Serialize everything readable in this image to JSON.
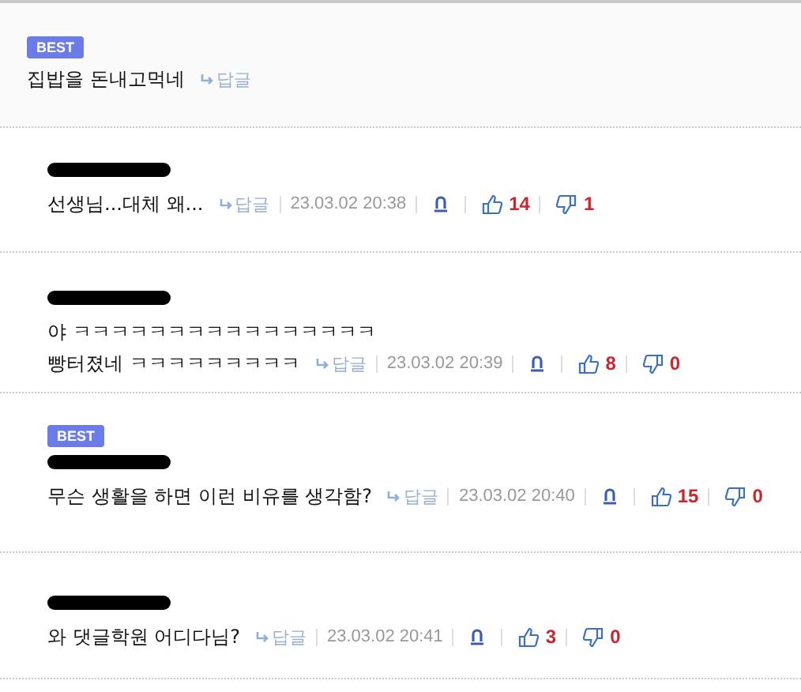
{
  "comments": [
    {
      "kind": "parent",
      "badge": "BEST",
      "lines": [
        "집밥을 돈내고먹네"
      ],
      "reply_label": "답글"
    },
    {
      "kind": "reply",
      "lines": [
        "선생님...대체 왜..."
      ],
      "reply_label": "답글",
      "date": "23.03.02 20:38",
      "likes": "14",
      "dislikes": "1"
    },
    {
      "kind": "reply",
      "lines": [
        "야 ㅋㅋㅋㅋㅋㅋㅋㅋㅋㅋㅋㅋㅋㅋㅋㅋ",
        "빵터졌네 ㅋㅋㅋㅋㅋㅋㅋㅋㅋ"
      ],
      "reply_label": "답글",
      "date": "23.03.02 20:39",
      "likes": "8",
      "dislikes": "0"
    },
    {
      "kind": "reply",
      "badge": "BEST",
      "lines": [
        "무슨 생활을 하면 이런 비유를 생각함?"
      ],
      "reply_label": "답글",
      "date": "23.03.02 20:40",
      "likes": "15",
      "dislikes": "0"
    },
    {
      "kind": "reply",
      "lines": [
        "와 댓글학원 어디다님?"
      ],
      "reply_label": "답글",
      "date": "23.03.02 20:41",
      "likes": "3",
      "dislikes": "0"
    }
  ]
}
